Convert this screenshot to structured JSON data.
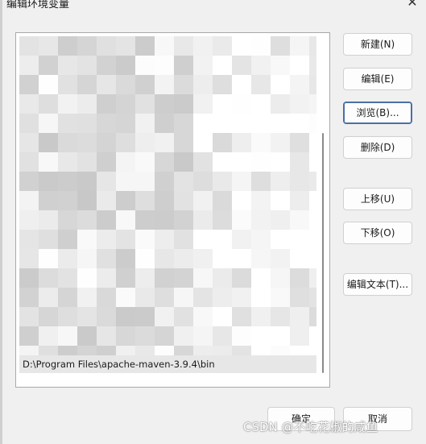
{
  "window": {
    "title": "编辑环境变量",
    "close_glyph": "✕"
  },
  "path_list": {
    "selected_entry": "D:\\Program Files\\apache-maven-3.9.4\\bin"
  },
  "buttons": {
    "new": "新建(N)",
    "edit": "编辑(E)",
    "browse": "浏览(B)...",
    "delete": "删除(D)",
    "move_up": "上移(U)",
    "move_down": "下移(O)",
    "edit_text": "编辑文本(T)...",
    "ok": "确定",
    "cancel": "取消"
  },
  "watermark": "CSDN @不吃花椒的咸鱼",
  "colors": {
    "focus_border": "#4a6fa5",
    "selected_row": "#e7e7e7"
  }
}
